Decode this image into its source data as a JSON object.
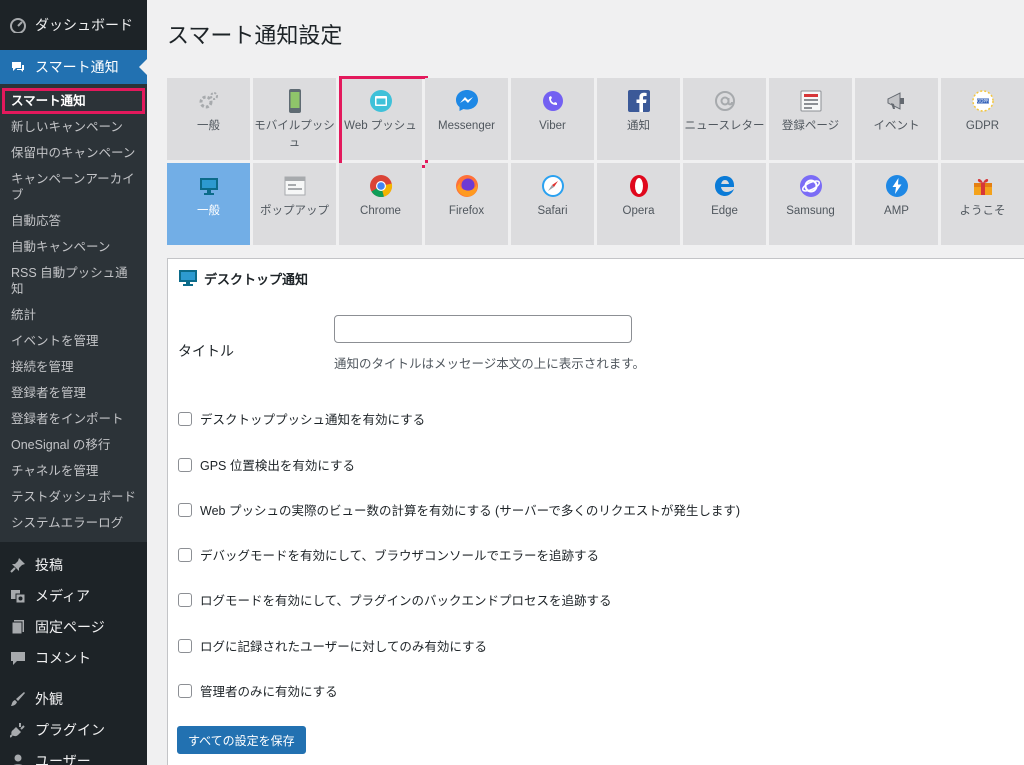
{
  "sidebar": {
    "dashboard": "ダッシュボード",
    "smart_notify": "スマート通知",
    "submenu": [
      "スマート通知",
      "新しいキャンペーン",
      "保留中のキャンペーン",
      "キャンペーンアーカイブ",
      "自動応答",
      "自動キャンペーン",
      "RSS 自動プッシュ通知",
      "統計",
      "イベントを管理",
      "接続を管理",
      "登録者を管理",
      "登録者をインポート",
      "OneSignal の移行",
      "チャネルを管理",
      "テストダッシュボード",
      "システムエラーログ"
    ],
    "posts": "投稿",
    "media": "メディア",
    "pages": "固定ページ",
    "comments": "コメント",
    "appearance": "外観",
    "plugins": "プラグイン",
    "users": "ユーザー"
  },
  "page": {
    "title": "スマート通知設定"
  },
  "tiles_row1": [
    {
      "label": "一般",
      "icon": "gear-icon"
    },
    {
      "label": "モバイルプッシュ",
      "icon": "mobile-icon"
    },
    {
      "label": "Web プッシュ",
      "icon": "web-push-icon"
    },
    {
      "label": "Messenger",
      "icon": "messenger-icon"
    },
    {
      "label": "Viber",
      "icon": "viber-icon"
    },
    {
      "label": "通知",
      "icon": "facebook-icon"
    },
    {
      "label": "ニュースレター",
      "icon": "newsletter-icon"
    },
    {
      "label": "登録ページ",
      "icon": "form-icon"
    },
    {
      "label": "イベント",
      "icon": "megaphone-icon"
    },
    {
      "label": "GDPR",
      "icon": "gdpr-icon"
    }
  ],
  "tiles_row2": [
    {
      "label": "一般",
      "icon": "desktop-icon"
    },
    {
      "label": "ポップアップ",
      "icon": "popup-icon"
    },
    {
      "label": "Chrome",
      "icon": "chrome-icon"
    },
    {
      "label": "Firefox",
      "icon": "firefox-icon"
    },
    {
      "label": "Safari",
      "icon": "safari-icon"
    },
    {
      "label": "Opera",
      "icon": "opera-icon"
    },
    {
      "label": "Edge",
      "icon": "edge-icon"
    },
    {
      "label": "Samsung",
      "icon": "samsung-icon"
    },
    {
      "label": "AMP",
      "icon": "amp-icon"
    },
    {
      "label": "ようこそ",
      "icon": "welcome-icon"
    }
  ],
  "panel": {
    "header": "デスクトップ通知",
    "title_label": "タイトル",
    "title_value": "",
    "title_help": "通知のタイトルはメッセージ本文の上に表示されます。",
    "checks": [
      "デスクトッププッシュ通知を有効にする",
      "GPS 位置検出を有効にする",
      "Web プッシュの実際のビュー数の計算を有効にする (サーバーで多くのリクエストが発生します)",
      "デバッグモードを有効にして、ブラウザコンソールでエラーを追跡する",
      "ログモードを有効にして、プラグインのバックエンドプロセスを追跡する",
      "ログに記録されたユーザーに対してのみ有効にする",
      "管理者のみに有効にする"
    ],
    "save_label": "すべての設定を保存"
  }
}
